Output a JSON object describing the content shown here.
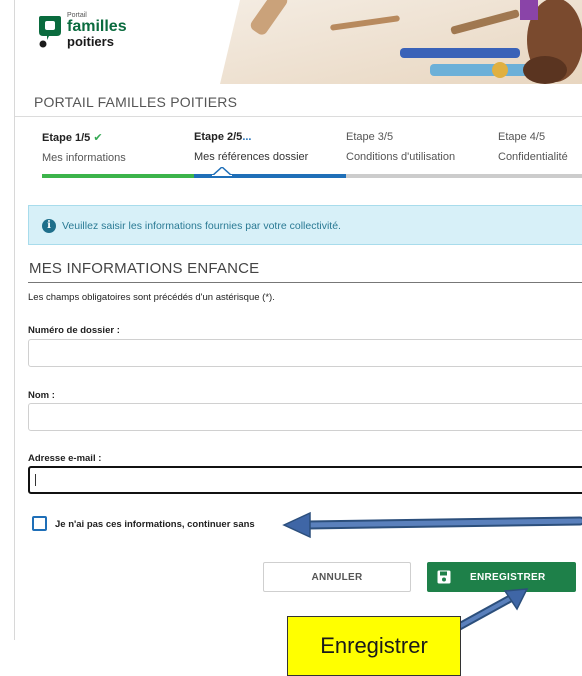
{
  "header": {
    "logo_small": "Portail",
    "logo_main": "familles",
    "logo_sub": "poitiers",
    "portal_title": "PORTAIL FAMILLES POITIERS"
  },
  "steps": [
    {
      "title": "Etape 1/5",
      "subtitle": "Mes informations",
      "status": "done"
    },
    {
      "title": "Etape 2/5",
      "subtitle": "Mes références dossier",
      "status": "current"
    },
    {
      "title": "Etape 3/5",
      "subtitle": "Conditions d'utilisation",
      "status": "todo"
    },
    {
      "title": "Etape 4/5",
      "subtitle": "Confidentialité",
      "status": "todo"
    }
  ],
  "info": {
    "message": "Veuillez saisir les informations fournies par votre collectivité."
  },
  "form": {
    "section_title": "MES INFORMATIONS ENFANCE",
    "required_note": "Les champs obligatoires sont précédés d'un astérisque (*).",
    "file_number_label": "Numéro de dossier :",
    "file_number_value": "",
    "name_label": "Nom :",
    "name_value": "",
    "email_label": "Adresse e-mail :",
    "email_value": "",
    "skip_checkbox_label": "Je n'ai pas ces informations, continuer sans",
    "skip_checked": false
  },
  "buttons": {
    "cancel": "ANNULER",
    "save": "ENREGISTRER"
  },
  "annotation": {
    "callout_text": "Enregistrer"
  },
  "colors": {
    "step_done": "#3cb44b",
    "step_current": "#1f6fb8",
    "step_todo": "#cccccc",
    "save_button": "#1e8049",
    "info_bg": "#d7f0f8",
    "callout_bg": "#ffff00",
    "annotation_arrow": "#4a6fa8"
  }
}
